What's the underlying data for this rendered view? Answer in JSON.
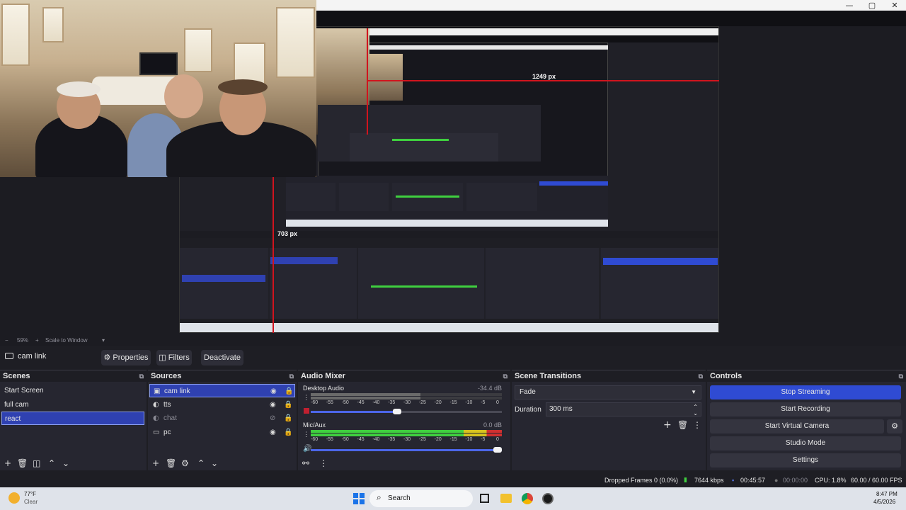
{
  "preview": {
    "measure_width": "1249 px",
    "measure_height": "703 px",
    "nested_width_small": "1249 px",
    "nested_height_small": "703 px",
    "window_controls": [
      "—",
      "▢",
      "✕"
    ]
  },
  "zoom_bar": {
    "minus": "−",
    "zoom": "59%",
    "plus": "+",
    "mode": "Scale to Window",
    "arrow": "▾"
  },
  "source_toolbar": {
    "source_name": "cam link",
    "properties": "Properties",
    "filters": "Filters",
    "deactivate": "Deactivate"
  },
  "scenes": {
    "title": "Scenes",
    "items": [
      "Start Screen",
      "full cam",
      "react"
    ],
    "selected_index": 2
  },
  "sources": {
    "title": "Sources",
    "items": [
      {
        "name": "cam link",
        "icon": "camera-icon",
        "visible": true
      },
      {
        "name": "tts",
        "icon": "browser-icon",
        "visible": true
      },
      {
        "name": "chat",
        "icon": "browser-icon",
        "visible": false
      },
      {
        "name": "pc",
        "icon": "display-icon",
        "visible": true
      }
    ]
  },
  "mixer": {
    "title": "Audio Mixer",
    "channels": [
      {
        "name": "Desktop Audio",
        "db": "-34.4 dB",
        "level": 0.45,
        "muted": true
      },
      {
        "name": "Mic/Aux",
        "db": "0.0 dB",
        "level": 1.0,
        "muted": false
      }
    ],
    "tick_labels": [
      "-60",
      "-55",
      "-50",
      "-45",
      "-40",
      "-35",
      "-30",
      "-25",
      "-20",
      "-15",
      "-10",
      "-5",
      "0"
    ]
  },
  "transitions": {
    "title": "Scene Transitions",
    "selected": "Fade",
    "duration_label": "Duration",
    "duration_value": "300 ms"
  },
  "controls": {
    "title": "Controls",
    "buttons": [
      "Stop Streaming",
      "Start Recording",
      "Start Virtual Camera",
      "Studio Mode",
      "Settings"
    ]
  },
  "status": {
    "dropped": "Dropped Frames 0 (0.0%)",
    "bitrate": "7644 kbps",
    "stream_time": "00:45:57",
    "rec_time": "00:00:00",
    "cpu": "CPU: 1.8%",
    "fps": "60.00 / 60.00 FPS"
  },
  "taskbar": {
    "weather_temp": "77°F",
    "weather_desc": "Clear",
    "search": "Search",
    "time": "8:47 PM",
    "date": "4/5/2026"
  },
  "colors": {
    "accent": "#2f4bd3",
    "selected_bg": "#2f41b1",
    "dock_bg": "#262630",
    "measure_red": "#d0141e",
    "meter_green": "#3fcf3f",
    "meter_yellow": "#d6c21e"
  }
}
